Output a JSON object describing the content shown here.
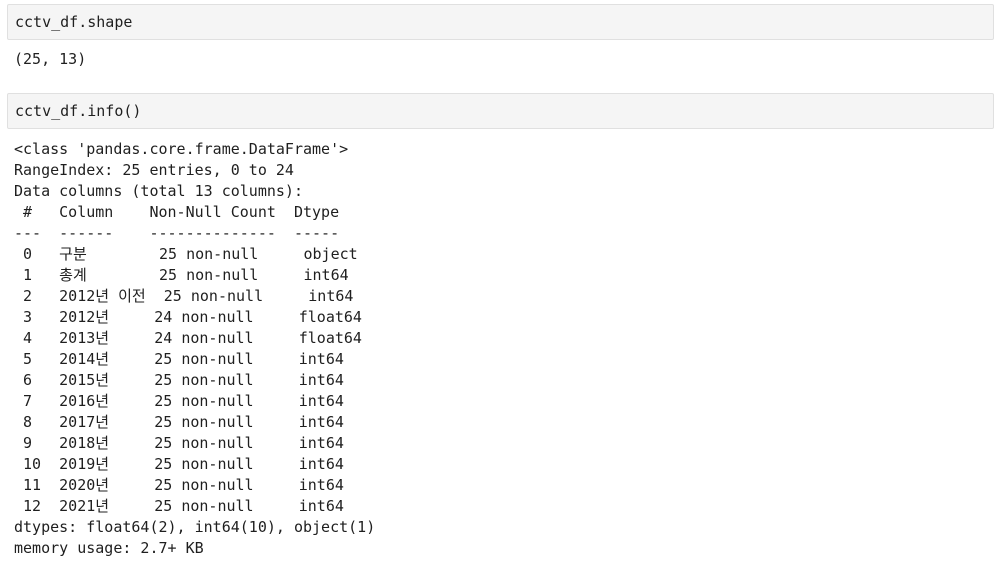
{
  "cells": [
    {
      "code": "cctv_df.shape",
      "output": "(25, 13)"
    },
    {
      "code": "cctv_df.info()",
      "output": "<class 'pandas.core.frame.DataFrame'>\nRangeIndex: 25 entries, 0 to 24\nData columns (total 13 columns):\n #   Column    Non-Null Count  Dtype  \n---  ------    --------------  -----  \n 0   구분        25 non-null     object \n 1   총계        25 non-null     int64  \n 2   2012년 이전  25 non-null     int64  \n 3   2012년     24 non-null     float64\n 4   2013년     24 non-null     float64\n 5   2014년     25 non-null     int64  \n 6   2015년     25 non-null     int64  \n 7   2016년     25 non-null     int64  \n 8   2017년     25 non-null     int64  \n 9   2018년     25 non-null     int64  \n 10  2019년     25 non-null     int64  \n 11  2020년     25 non-null     int64  \n 12  2021년     25 non-null     int64  \ndtypes: float64(2), int64(10), object(1)\nmemory usage: 2.7+ KB"
    }
  ]
}
